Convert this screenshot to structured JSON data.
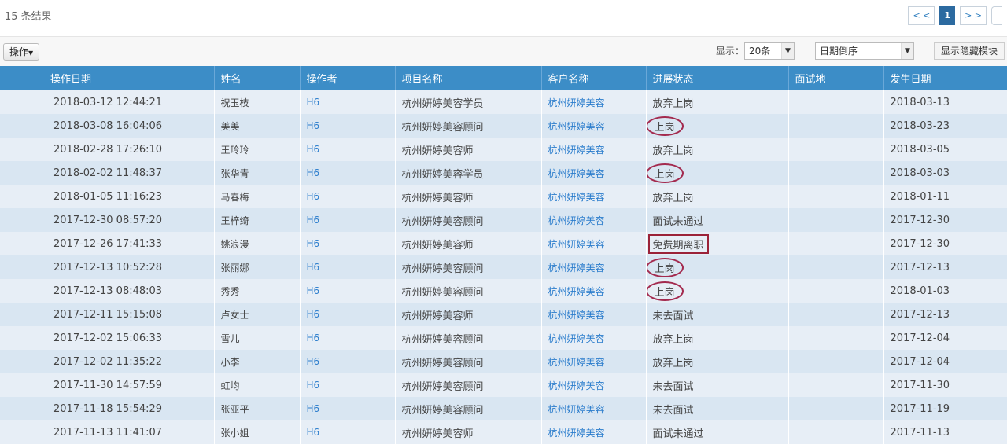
{
  "header": {
    "result_count": "15 条结果",
    "pager": {
      "prev": "< <",
      "page": "1",
      "next": "> >"
    }
  },
  "toolbar": {
    "operation_label": "操作",
    "show_label": "显示：",
    "page_size": "20条",
    "sort_order": "日期倒序",
    "toggle_hidden_label": "显示隐藏模块"
  },
  "table": {
    "columns": [
      "操作日期",
      "姓名",
      "操作者",
      "项目名称",
      "客户名称",
      "进展状态",
      "面试地",
      "发生日期"
    ],
    "rows": [
      {
        "date": "2018-03-12 12:44:21",
        "name": "祝玉枝",
        "operator": "H6",
        "project": "杭州妍婷美容学员",
        "customer": "杭州妍婷美容",
        "status": "放弃上岗",
        "location": "",
        "occur": "2018-03-13",
        "mark": "none"
      },
      {
        "date": "2018-03-08 16:04:06",
        "name": "美美",
        "operator": "H6",
        "project": "杭州妍婷美容顾问",
        "customer": "杭州妍婷美容",
        "status": "上岗",
        "location": "",
        "occur": "2018-03-23",
        "mark": "circle"
      },
      {
        "date": "2018-02-28 17:26:10",
        "name": "王玲玲",
        "operator": "H6",
        "project": "杭州妍婷美容师",
        "customer": "杭州妍婷美容",
        "status": "放弃上岗",
        "location": "",
        "occur": "2018-03-05",
        "mark": "none"
      },
      {
        "date": "2018-02-02 11:48:37",
        "name": "张华青",
        "operator": "H6",
        "project": "杭州妍婷美容学员",
        "customer": "杭州妍婷美容",
        "status": "上岗",
        "location": "",
        "occur": "2018-03-03",
        "mark": "circle"
      },
      {
        "date": "2018-01-05 11:16:23",
        "name": "马春梅",
        "operator": "H6",
        "project": "杭州妍婷美容师",
        "customer": "杭州妍婷美容",
        "status": "放弃上岗",
        "location": "",
        "occur": "2018-01-11",
        "mark": "none"
      },
      {
        "date": "2017-12-30 08:57:20",
        "name": "王梓绮",
        "operator": "H6",
        "project": "杭州妍婷美容顾问",
        "customer": "杭州妍婷美容",
        "status": "面试未通过",
        "location": "",
        "occur": "2017-12-30",
        "mark": "none"
      },
      {
        "date": "2017-12-26 17:41:33",
        "name": "姚浪漫",
        "operator": "H6",
        "project": "杭州妍婷美容师",
        "customer": "杭州妍婷美容",
        "status": "免费期离职",
        "location": "",
        "occur": "2017-12-30",
        "mark": "box"
      },
      {
        "date": "2017-12-13 10:52:28",
        "name": "张丽娜",
        "operator": "H6",
        "project": "杭州妍婷美容顾问",
        "customer": "杭州妍婷美容",
        "status": "上岗",
        "location": "",
        "occur": "2017-12-13",
        "mark": "circle"
      },
      {
        "date": "2017-12-13 08:48:03",
        "name": "秀秀",
        "operator": "H6",
        "project": "杭州妍婷美容顾问",
        "customer": "杭州妍婷美容",
        "status": "上岗",
        "location": "",
        "occur": "2018-01-03",
        "mark": "circle"
      },
      {
        "date": "2017-12-11 15:15:08",
        "name": "卢女士",
        "operator": "H6",
        "project": "杭州妍婷美容师",
        "customer": "杭州妍婷美容",
        "status": "未去面试",
        "location": "",
        "occur": "2017-12-13",
        "mark": "none"
      },
      {
        "date": "2017-12-02 15:06:33",
        "name": "雪儿",
        "operator": "H6",
        "project": "杭州妍婷美容顾问",
        "customer": "杭州妍婷美容",
        "status": "放弃上岗",
        "location": "",
        "occur": "2017-12-04",
        "mark": "none"
      },
      {
        "date": "2017-12-02 11:35:22",
        "name": "小李",
        "operator": "H6",
        "project": "杭州妍婷美容顾问",
        "customer": "杭州妍婷美容",
        "status": "放弃上岗",
        "location": "",
        "occur": "2017-12-04",
        "mark": "none"
      },
      {
        "date": "2017-11-30 14:57:59",
        "name": "虹均",
        "operator": "H6",
        "project": "杭州妍婷美容顾问",
        "customer": "杭州妍婷美容",
        "status": "未去面试",
        "location": "",
        "occur": "2017-11-30",
        "mark": "none"
      },
      {
        "date": "2017-11-18 15:54:29",
        "name": "张亚平",
        "operator": "H6",
        "project": "杭州妍婷美容顾问",
        "customer": "杭州妍婷美容",
        "status": "未去面试",
        "location": "",
        "occur": "2017-11-19",
        "mark": "none"
      },
      {
        "date": "2017-11-13 11:41:07",
        "name": "张小姐",
        "operator": "H6",
        "project": "杭州妍婷美容师",
        "customer": "杭州妍婷美容",
        "status": "面试未通过",
        "location": "",
        "occur": "2017-11-13",
        "mark": "none"
      }
    ]
  },
  "colors": {
    "header_bg": "#3c8dc7",
    "link": "#2a7ccc",
    "highlight": "#a32a4e"
  }
}
